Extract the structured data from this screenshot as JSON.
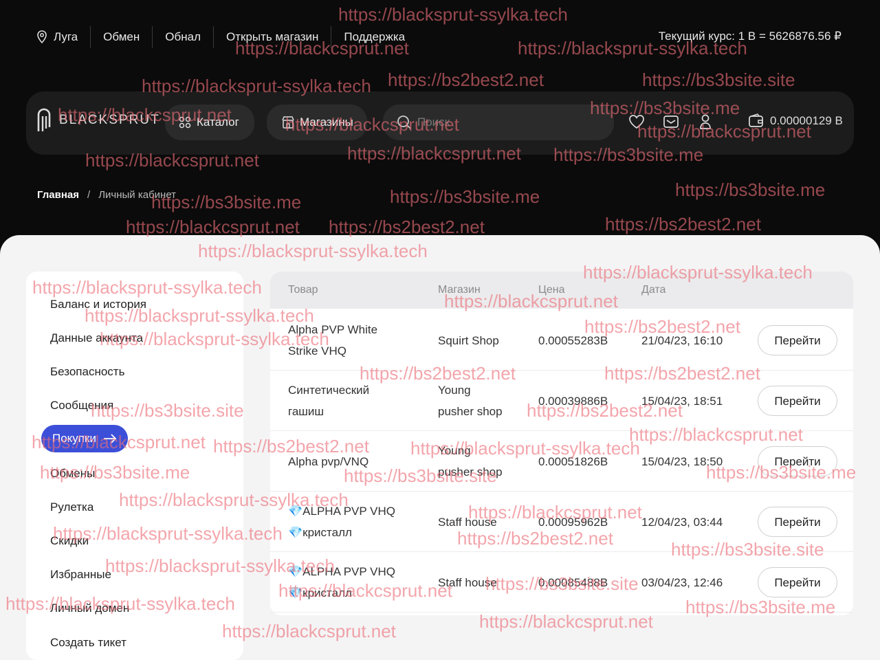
{
  "topnav": {
    "city": "Луга",
    "exchange": "Обмен",
    "cashout": "Обнал",
    "open_shop": "Открыть магазин",
    "support": "Поддержка",
    "rate": "Текущий курс: 1 B = 5626876.56 ₽"
  },
  "header": {
    "logo_text": "BLACKSPRUT",
    "catalog": "Каталог",
    "shops": "Магазины",
    "search_placeholder": "Поиск",
    "balance": "0.00000129 B"
  },
  "breadcrumb": {
    "home": "Главная",
    "separator": "/",
    "current": "Личный кабинет"
  },
  "sidebar": {
    "items": [
      {
        "label": "Баланс и история"
      },
      {
        "label": "Данные аккаунта"
      },
      {
        "label": "Безопасность"
      },
      {
        "label": "Сообщения"
      },
      {
        "label": "Покупки",
        "active": true
      },
      {
        "label": "Обмены"
      },
      {
        "label": "Рулетка"
      },
      {
        "label": "Скидки"
      },
      {
        "label": "Избранные"
      },
      {
        "label": "Личный домен"
      },
      {
        "label": "Создать тикет"
      }
    ]
  },
  "table": {
    "columns": [
      "Товар",
      "Магазин",
      "Цена",
      "Дата"
    ],
    "rows": [
      {
        "product_line1": "Alpha PVP White",
        "product_line2": "Strike VHQ",
        "shop_line1": "Squirt Shop",
        "shop_line2": "",
        "price": "0.00055283B",
        "date": "21/04/23, 16:10",
        "action": "Перейти"
      },
      {
        "product_line1": "Синтетический",
        "product_line2": "гашиш",
        "shop_line1": "Young",
        "shop_line2": "pusher shop",
        "price": "0.00039886B",
        "date": "15/04/23, 18:51",
        "action": "Перейти"
      },
      {
        "product_line1": "Alpha pvp/VNQ",
        "product_line2": "",
        "shop_line1": "Young",
        "shop_line2": "pusher shop",
        "price": "0.00051826B",
        "date": "15/04/23, 18:50",
        "action": "Перейти"
      },
      {
        "product_line1": "💎ALPHA PVP VHQ",
        "product_line2": "💎кристалл",
        "shop_line1": "Staff house",
        "shop_line2": "",
        "price": "0.00095962B",
        "date": "12/04/23, 03:44",
        "action": "Перейти"
      },
      {
        "product_line1": "💎ALPHA PVP VHQ",
        "product_line2": "💎кристалл",
        "shop_line1": "Staff house",
        "shop_line2": "",
        "price": "0.00085488B",
        "date": "03/04/23, 12:46",
        "action": "Перейти"
      }
    ]
  },
  "watermarks": [
    "https://blacksprut-ssylka.tech",
    "https://blackcsprut.net",
    "https://blacksprut-ssylka.tech",
    "https://bs2best2.net",
    "https://blacksprut-ssylka.tech",
    "https://bs3bsite.site",
    "https://blackcsprut.net",
    "https://bs3bsite.me",
    "https://blackcsprut.net",
    "https://blackcsprut.net",
    "https://blackcsprut.net",
    "https://bs3bsite.me",
    "https://blackcsprut.net",
    "https://bs3bsite.me",
    "https://bs3bsite.me",
    "https://bs3bsite.me",
    "https://blackcsprut.net",
    "https://bs2best2.net",
    "https://bs2best2.net",
    "https://blacksprut-ssylka.tech",
    "https://blacksprut-ssylka.tech",
    "https://blackcsprut.net",
    "https://blacksprut-ssylka.tech",
    "https://bs2best2.net",
    "https://blacksprut-ssylka.tech",
    "https://blacksprut-ssylka.tech",
    "https://bs2best2.net",
    "https://bs2best2.net",
    "https://bs3bsite.site",
    "https://bs2best2.net",
    "https://blackcsprut.net",
    "https://blackcsprut.net",
    "https://bs2best2.net",
    "https://blacksprut-ssylka.tech",
    "https://bs3bsite.me",
    "https://bs3bsite.site",
    "https://bs3bsite.me",
    "https://blacksprut-ssylka.tech",
    "https://blackcsprut.net",
    "https://blacksprut-ssylka.tech",
    "https://bs2best2.net",
    "https://bs3bsite.site",
    "https://blacksprut-ssylka.tech",
    "https://bs3bsite.site",
    "https://blackcsprut.net",
    "https://blacksprut-ssylka.tech",
    "https://bs3bsite.me",
    "https://blackcsprut.net",
    "https://blackcsprut.net"
  ]
}
